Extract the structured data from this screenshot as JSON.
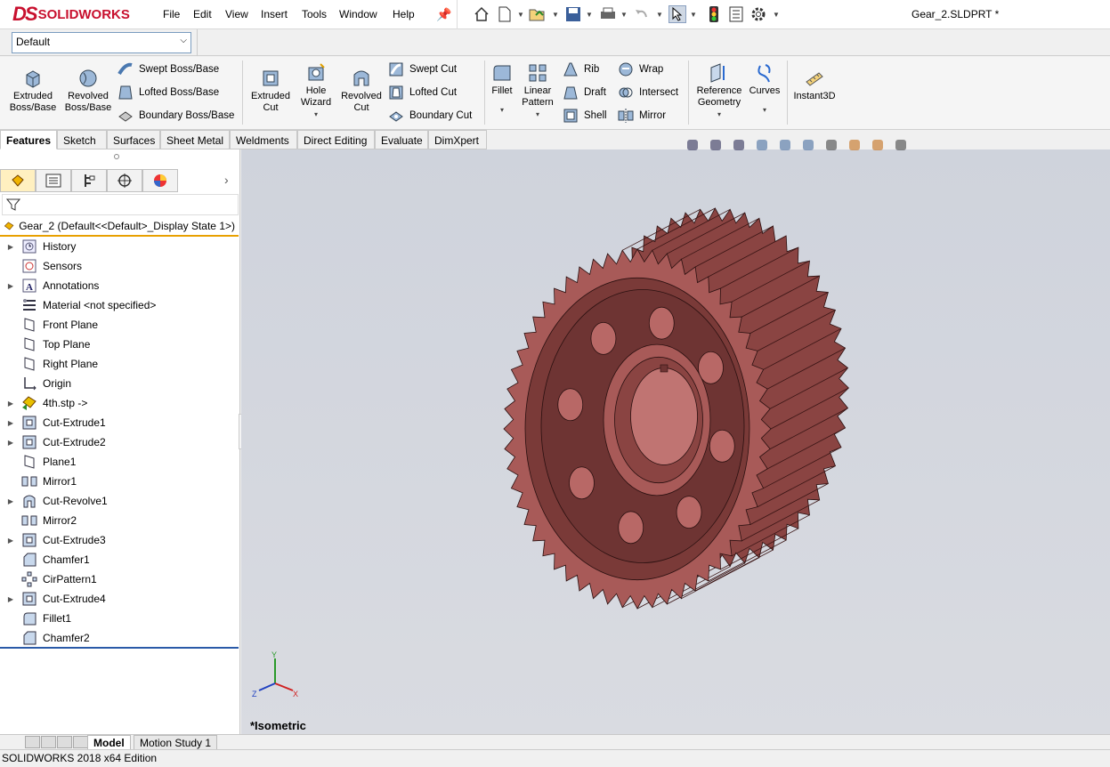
{
  "app": {
    "logo_ds": "DS",
    "logo_text": "SOLIDWORKS",
    "menu": [
      "File",
      "Edit",
      "View",
      "Insert",
      "Tools",
      "Window",
      "Help"
    ],
    "document_title": "Gear_2.SLDPRT *"
  },
  "config": {
    "selected": "Default"
  },
  "command_manager": {
    "extruded_boss": "Extruded Boss/Base",
    "revolved_boss": "Revolved Boss/Base",
    "swept_boss": "Swept Boss/Base",
    "lofted_boss": "Lofted Boss/Base",
    "boundary_boss": "Boundary Boss/Base",
    "extruded_cut": "Extruded Cut",
    "hole_wizard": "Hole Wizard",
    "revolved_cut": "Revolved Cut",
    "swept_cut": "Swept Cut",
    "lofted_cut": "Lofted Cut",
    "boundary_cut": "Boundary Cut",
    "fillet": "Fillet",
    "linear_pattern": "Linear Pattern",
    "rib": "Rib",
    "draft": "Draft",
    "shell": "Shell",
    "wrap": "Wrap",
    "intersect": "Intersect",
    "mirror": "Mirror",
    "reference_geometry": "Reference Geometry",
    "curves": "Curves",
    "instant3d": "Instant3D"
  },
  "tabs": [
    "Features",
    "Sketch",
    "Surfaces",
    "Sheet Metal",
    "Weldments",
    "Direct Editing",
    "Evaluate",
    "DimXpert"
  ],
  "tree": {
    "root": "Gear_2  (Default<<Default>_Display State 1>)",
    "items": [
      {
        "label": "History",
        "icon": "history-icon",
        "expandable": true
      },
      {
        "label": "Sensors",
        "icon": "sensors-icon",
        "expandable": false
      },
      {
        "label": "Annotations",
        "icon": "annotations-icon",
        "expandable": true
      },
      {
        "label": "Material <not specified>",
        "icon": "material-icon",
        "expandable": false
      },
      {
        "label": "Front Plane",
        "icon": "plane-icon",
        "expandable": false
      },
      {
        "label": "Top Plane",
        "icon": "plane-icon",
        "expandable": false
      },
      {
        "label": "Right Plane",
        "icon": "plane-icon",
        "expandable": false
      },
      {
        "label": "Origin",
        "icon": "origin-icon",
        "expandable": false
      },
      {
        "label": "4th.stp ->",
        "icon": "imported-body-icon",
        "expandable": true
      },
      {
        "label": "Cut-Extrude1",
        "icon": "cut-extrude-icon",
        "expandable": true
      },
      {
        "label": "Cut-Extrude2",
        "icon": "cut-extrude-icon",
        "expandable": true
      },
      {
        "label": "Plane1",
        "icon": "plane-icon",
        "expandable": false
      },
      {
        "label": "Mirror1",
        "icon": "mirror-icon",
        "expandable": false
      },
      {
        "label": "Cut-Revolve1",
        "icon": "cut-revolve-icon",
        "expandable": true
      },
      {
        "label": "Mirror2",
        "icon": "mirror-icon",
        "expandable": false
      },
      {
        "label": "Cut-Extrude3",
        "icon": "cut-extrude-icon",
        "expandable": true
      },
      {
        "label": "Chamfer1",
        "icon": "chamfer-icon",
        "expandable": false
      },
      {
        "label": "CirPattern1",
        "icon": "circular-pattern-icon",
        "expandable": false
      },
      {
        "label": "Cut-Extrude4",
        "icon": "cut-extrude-icon",
        "expandable": true
      },
      {
        "label": "Fillet1",
        "icon": "fillet-icon",
        "expandable": false
      },
      {
        "label": "Chamfer2",
        "icon": "chamfer-icon",
        "expandable": false
      }
    ]
  },
  "viewport": {
    "view_label": "*Isometric",
    "axis_x": "X",
    "axis_y": "Y",
    "axis_z": "Z",
    "model_color": "#a85a58"
  },
  "bottom_tabs": [
    "Model",
    "Motion Study 1"
  ],
  "status": "SOLIDWORKS 2018 x64 Edition"
}
